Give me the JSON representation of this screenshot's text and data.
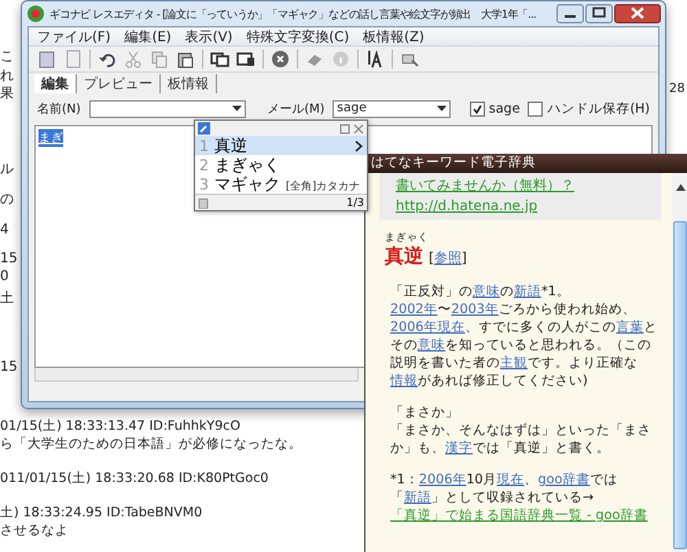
{
  "background": {
    "fragments": [
      "こ",
      "れ",
      "果",
      "ル",
      "の",
      "4",
      "15",
      "0",
      "土",
      "15"
    ],
    "right_fragment": "28",
    "posts": [
      {
        "kind": "header",
        "text": "01/15(土) 18:33:13.47 ID:FuhhkY9cO"
      },
      {
        "kind": "body",
        "text": "ら「大学生のための日本語」が必修になったな。"
      },
      {
        "kind": "header",
        "text": "011/01/15(土) 18:33:20.68 ID:K80PtGoc0"
      },
      {
        "kind": "header",
        "text": "土) 18:33:24.95 ID:TabeBNVM0"
      },
      {
        "kind": "body",
        "text": "させるなよ"
      }
    ]
  },
  "window": {
    "title": "ギコナビ レスエディタ - [論文に「っていうか」「マギャク」などの話し言葉や絵文字が頻出　大学1年「..."
  },
  "menu": [
    "ファイル(F)",
    "編集(E)",
    "表示(V)",
    "特殊文字変換(C)",
    "板情報(Z)"
  ],
  "tabs": [
    {
      "label": "編集",
      "selected": true
    },
    {
      "label": "プレビュー",
      "selected": false
    },
    {
      "label": "板情報",
      "selected": false
    }
  ],
  "form": {
    "name_label": "名前(N)",
    "mail_label": "メール(M)",
    "mail_value": "sage",
    "checkboxes": [
      {
        "label": "sage",
        "checked": true
      },
      {
        "label": "ハンドル保存(H)",
        "checked": false
      }
    ]
  },
  "editor": {
    "composition": "まぎ"
  },
  "candidates": {
    "items": [
      {
        "number": "1",
        "text": "真逆",
        "selected": true
      },
      {
        "number": "2",
        "text": "まぎゃく",
        "selected": false
      },
      {
        "number": "3",
        "text": "マギャク",
        "note": "[全角]カタカナ",
        "selected": false
      }
    ],
    "page": "1/3"
  },
  "dictionary": {
    "title": "はてなキーワード電子辞典",
    "ad_links": [
      "書いてみませんか（無料）？",
      "http://d.hatena.ne.jp"
    ],
    "reading": "まぎゃく",
    "headword": "真逆",
    "ref_open": "[",
    "ref_link": "参照",
    "ref_close": "]",
    "paragraphs": [
      [
        [
          {
            "kind": "text",
            "text": "「正反対」の"
          },
          {
            "kind": "link",
            "text": "意味"
          },
          {
            "kind": "text",
            "text": "の"
          },
          {
            "kind": "link",
            "text": "新語"
          },
          {
            "kind": "text",
            "text": "*1。"
          }
        ],
        [
          {
            "kind": "link",
            "text": "2002年"
          },
          {
            "kind": "text",
            "text": "〜"
          },
          {
            "kind": "link",
            "text": "2003年"
          },
          {
            "kind": "text",
            "text": "ごろから使われ始め、"
          },
          {
            "kind": "link",
            "text": "2006年現在"
          },
          {
            "kind": "text",
            "text": "、すでに多くの人がこの"
          },
          {
            "kind": "link",
            "text": "言葉"
          },
          {
            "kind": "text",
            "text": "とその"
          },
          {
            "kind": "link",
            "text": "意味"
          },
          {
            "kind": "text",
            "text": "を知っていると思われる。（この説明を書いた者の"
          },
          {
            "kind": "link",
            "text": "主観"
          },
          {
            "kind": "text",
            "text": "です。より正確な"
          },
          {
            "kind": "link",
            "text": "情報"
          },
          {
            "kind": "text",
            "text": "があれば修正してください)"
          }
        ]
      ],
      [
        [
          {
            "kind": "text",
            "text": "「まさか」"
          }
        ],
        [
          {
            "kind": "text",
            "text": "「まさか、そんなはずは」といった「まさか」も、"
          },
          {
            "kind": "link",
            "text": "漢字"
          },
          {
            "kind": "text",
            "text": "では「真逆」と書く。"
          }
        ]
      ],
      [
        [
          {
            "kind": "text",
            "text": "*1："
          },
          {
            "kind": "link",
            "text": "2006年"
          },
          {
            "kind": "text",
            "text": "10月"
          },
          {
            "kind": "link",
            "text": "現在"
          },
          {
            "kind": "text",
            "text": "、"
          },
          {
            "kind": "link",
            "text": "goo辞書"
          },
          {
            "kind": "text",
            "text": "では「"
          },
          {
            "kind": "link",
            "text": "新語"
          },
          {
            "kind": "text",
            "text": "」として収録されている→"
          },
          {
            "kind": "ext",
            "text": "「真逆」で始まる国語辞典"
          },
          {
            "kind": "ext",
            "text": "一覧 - goo辞書"
          }
        ]
      ]
    ]
  }
}
